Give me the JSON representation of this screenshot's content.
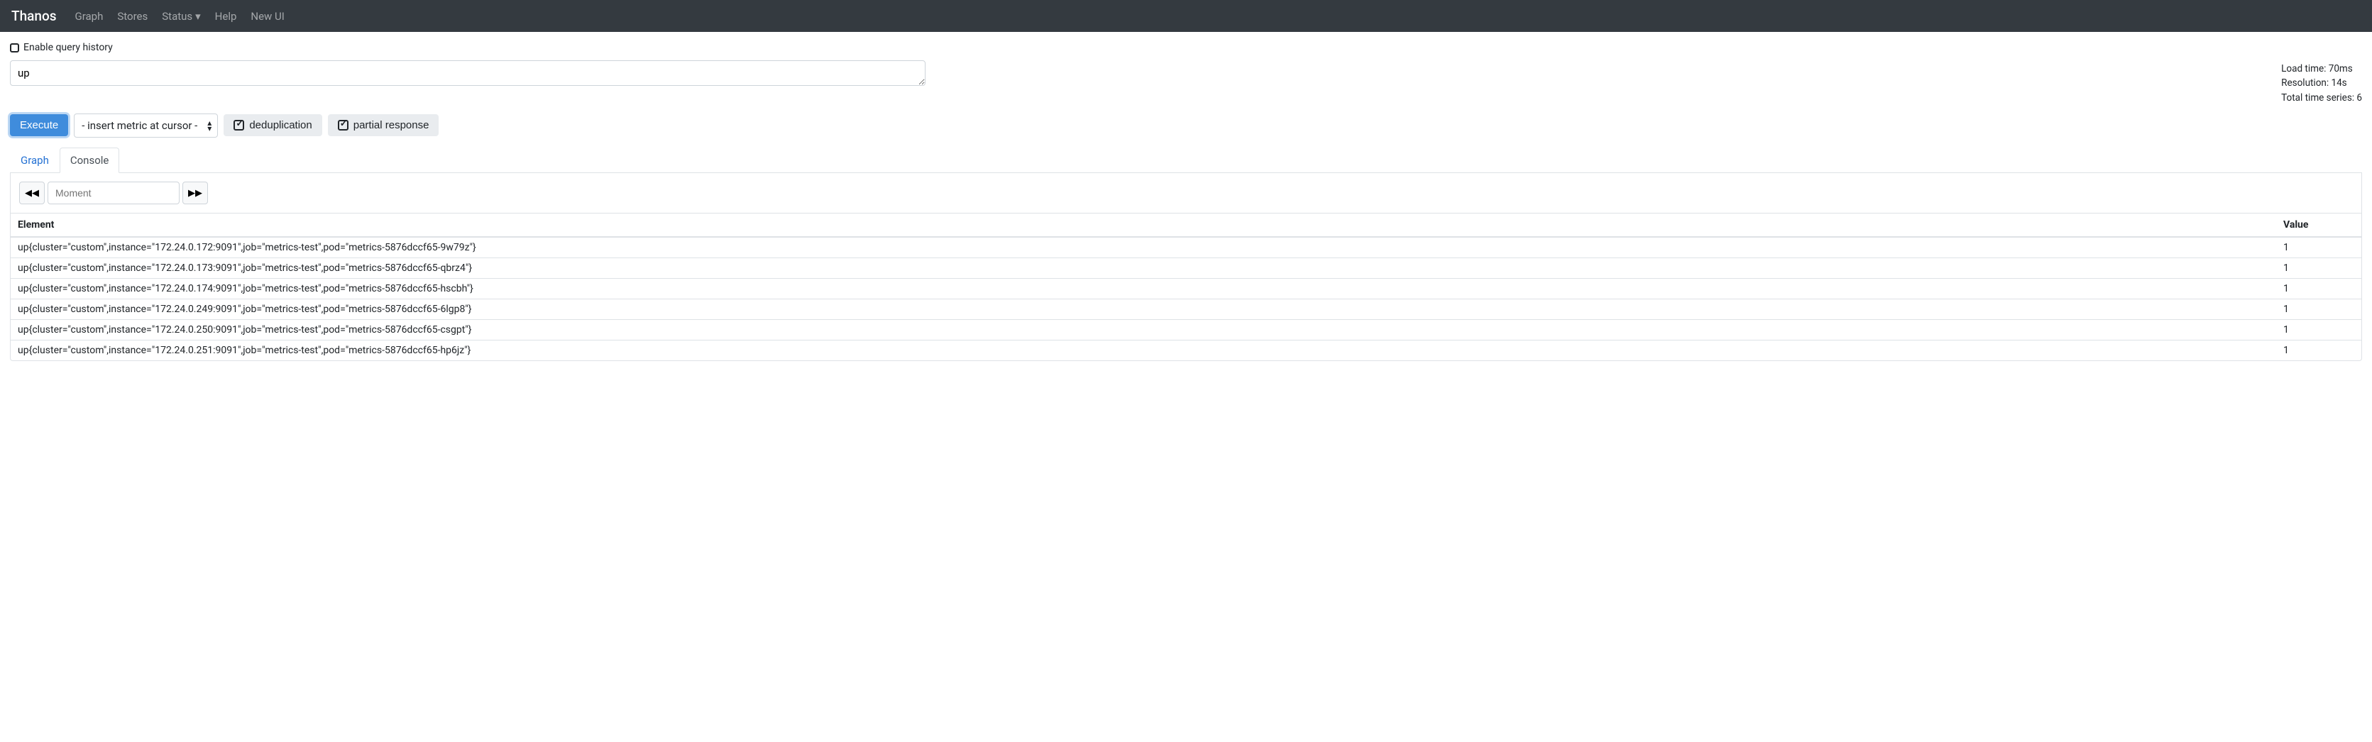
{
  "navbar": {
    "brand": "Thanos",
    "items": [
      "Graph",
      "Stores",
      "Status",
      "Help",
      "New UI"
    ],
    "status_has_caret": true
  },
  "checkbox": {
    "label": "Enable query history"
  },
  "query": {
    "value": "up"
  },
  "stats": {
    "load_time": "Load time: 70ms",
    "resolution": "Resolution: 14s",
    "total_series": "Total time series: 6"
  },
  "controls": {
    "execute": "Execute",
    "metric_placeholder": "- insert metric at cursor -",
    "dedup": "deduplication",
    "partial": "partial response"
  },
  "tabs": {
    "graph": "Graph",
    "console": "Console"
  },
  "moment": {
    "placeholder": "Moment"
  },
  "table": {
    "headers": {
      "element": "Element",
      "value": "Value"
    },
    "rows": [
      {
        "element": "up{cluster=\"custom\",instance=\"172.24.0.172:9091\",job=\"metrics-test\",pod=\"metrics-5876dccf65-9w79z\"}",
        "value": "1"
      },
      {
        "element": "up{cluster=\"custom\",instance=\"172.24.0.173:9091\",job=\"metrics-test\",pod=\"metrics-5876dccf65-qbrz4\"}",
        "value": "1"
      },
      {
        "element": "up{cluster=\"custom\",instance=\"172.24.0.174:9091\",job=\"metrics-test\",pod=\"metrics-5876dccf65-hscbh\"}",
        "value": "1"
      },
      {
        "element": "up{cluster=\"custom\",instance=\"172.24.0.249:9091\",job=\"metrics-test\",pod=\"metrics-5876dccf65-6lgp8\"}",
        "value": "1"
      },
      {
        "element": "up{cluster=\"custom\",instance=\"172.24.0.250:9091\",job=\"metrics-test\",pod=\"metrics-5876dccf65-csgpt\"}",
        "value": "1"
      },
      {
        "element": "up{cluster=\"custom\",instance=\"172.24.0.251:9091\",job=\"metrics-test\",pod=\"metrics-5876dccf65-hp6jz\"}",
        "value": "1"
      }
    ]
  }
}
